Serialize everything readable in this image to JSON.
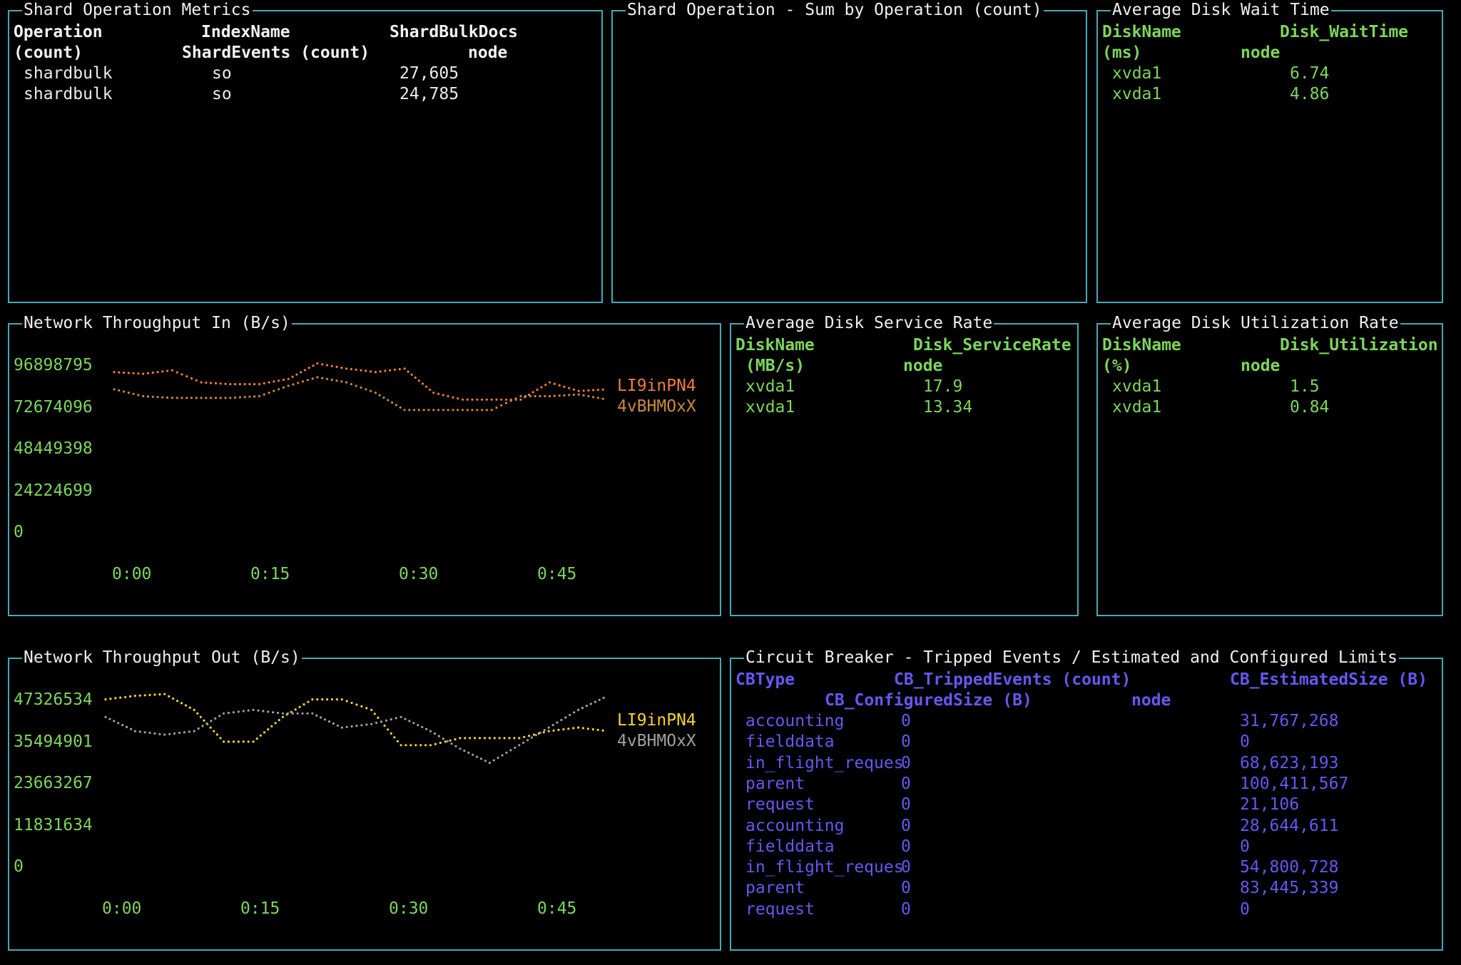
{
  "shard_metrics": {
    "title": "Shard Operation Metrics",
    "headers_line1": [
      "Operation",
      "IndexName",
      "ShardBulkDocs"
    ],
    "headers_line2": [
      "(count)",
      "ShardEvents (count)",
      "node"
    ],
    "rows": [
      [
        "shardbulk",
        "so",
        "27,605"
      ],
      [
        "shardbulk",
        "so",
        "24,785"
      ]
    ]
  },
  "shard_sum": {
    "title": "Shard Operation - Sum by Operation (count)"
  },
  "disk_wait": {
    "title": "Average Disk Wait Time",
    "headers_line1": [
      "DiskName",
      "Disk_WaitTime"
    ],
    "headers_line2": [
      "(ms)",
      "node"
    ],
    "rows": [
      [
        "xvda1",
        "6.74"
      ],
      [
        "xvda1",
        "4.86"
      ]
    ]
  },
  "disk_service": {
    "title": "Average Disk Service Rate",
    "headers_line1": [
      "DiskName",
      "Disk_ServiceRate"
    ],
    "headers_line2": [
      "(MB/s)",
      "node"
    ],
    "rows": [
      [
        "xvda1",
        "17.9"
      ],
      [
        "xvda1",
        "13.34"
      ]
    ]
  },
  "disk_util": {
    "title": "Average Disk Utilization Rate",
    "headers_line1": [
      "DiskName",
      "Disk_Utilization"
    ],
    "headers_line2": [
      "(%)",
      "node"
    ],
    "rows": [
      [
        "xvda1",
        "1.5"
      ],
      [
        "xvda1",
        "0.84"
      ]
    ]
  },
  "net_in": {
    "title": "Network Throughput In (B/s)",
    "y_ticks": [
      "96898795",
      "72674096",
      "48449398",
      "24224699",
      "0"
    ],
    "x_ticks": [
      "0:00",
      "0:15",
      "0:30",
      "0:45"
    ],
    "legend": [
      "LI9inPN4",
      "4vBHMOxX"
    ],
    "colors": [
      "#ef7d3a",
      "#c98a3c"
    ]
  },
  "net_out": {
    "title": "Network Throughput Out (B/s)",
    "y_ticks": [
      "47326534",
      "35494901",
      "23663267",
      "11831634",
      "0"
    ],
    "x_ticks": [
      "0:00",
      "0:15",
      "0:30",
      "0:45"
    ],
    "legend": [
      "LI9inPN4",
      "4vBHMOxX"
    ],
    "colors": [
      "#f5d233",
      "#a0a0a0"
    ]
  },
  "chart_data": [
    {
      "type": "line",
      "title": "Network Throughput In (B/s)",
      "ylim": [
        0,
        96898795
      ],
      "x": [
        "0:00",
        "0:03",
        "0:06",
        "0:09",
        "0:12",
        "0:15",
        "0:18",
        "0:21",
        "0:24",
        "0:27",
        "0:30",
        "0:33",
        "0:36",
        "0:39",
        "0:42",
        "0:45",
        "0:48",
        "0:50"
      ],
      "series": [
        {
          "name": "LI9inPN4",
          "values": [
            90000000,
            89000000,
            91000000,
            84000000,
            83000000,
            83000000,
            86000000,
            95000000,
            92000000,
            90000000,
            92000000,
            78000000,
            74000000,
            74000000,
            74000000,
            84000000,
            79000000,
            80000000
          ]
        },
        {
          "name": "4vBHMOxX",
          "values": [
            80000000,
            76000000,
            75000000,
            75000000,
            75000000,
            76000000,
            82000000,
            87000000,
            84000000,
            78000000,
            68000000,
            68000000,
            68000000,
            68000000,
            76000000,
            76000000,
            77000000,
            74000000
          ]
        }
      ]
    },
    {
      "type": "line",
      "title": "Network Throughput Out (B/s)",
      "ylim": [
        0,
        47326534
      ],
      "x": [
        "0:00",
        "0:03",
        "0:06",
        "0:09",
        "0:12",
        "0:15",
        "0:18",
        "0:21",
        "0:24",
        "0:27",
        "0:30",
        "0:33",
        "0:36",
        "0:39",
        "0:42",
        "0:45",
        "0:48",
        "0:50"
      ],
      "series": [
        {
          "name": "LI9inPN4",
          "values": [
            46000000,
            47000000,
            47500000,
            43000000,
            34000000,
            34000000,
            41000000,
            46000000,
            46000000,
            43000000,
            33000000,
            33000000,
            35000000,
            35000000,
            35000000,
            37000000,
            38000000,
            37000000
          ]
        },
        {
          "name": "4vBHMOxX",
          "values": [
            41000000,
            37000000,
            36000000,
            37000000,
            42000000,
            43000000,
            42000000,
            42000000,
            38000000,
            39000000,
            41000000,
            37000000,
            32000000,
            28000000,
            33000000,
            38000000,
            43000000,
            47000000
          ]
        }
      ]
    }
  ],
  "circuit_breaker": {
    "title": "Circuit Breaker - Tripped Events / Estimated and Configured Limits",
    "headers_line1": [
      "CBType",
      "CB_TrippedEvents (count)",
      "CB_EstimatedSize (B)"
    ],
    "headers_line2": [
      "CB_ConfiguredSize (B)",
      "node"
    ],
    "rows": [
      [
        "accounting",
        "0",
        "31,767,268"
      ],
      [
        "fielddata",
        "0",
        "0"
      ],
      [
        "in_flight_reques",
        "0",
        "68,623,193"
      ],
      [
        "parent",
        "0",
        "100,411,567"
      ],
      [
        "request",
        "0",
        "21,106"
      ],
      [
        "accounting",
        "0",
        "28,644,611"
      ],
      [
        "fielddata",
        "0",
        "0"
      ],
      [
        "in_flight_reques",
        "0",
        "54,800,728"
      ],
      [
        "parent",
        "0",
        "83,445,339"
      ],
      [
        "request",
        "0",
        "0"
      ]
    ]
  }
}
